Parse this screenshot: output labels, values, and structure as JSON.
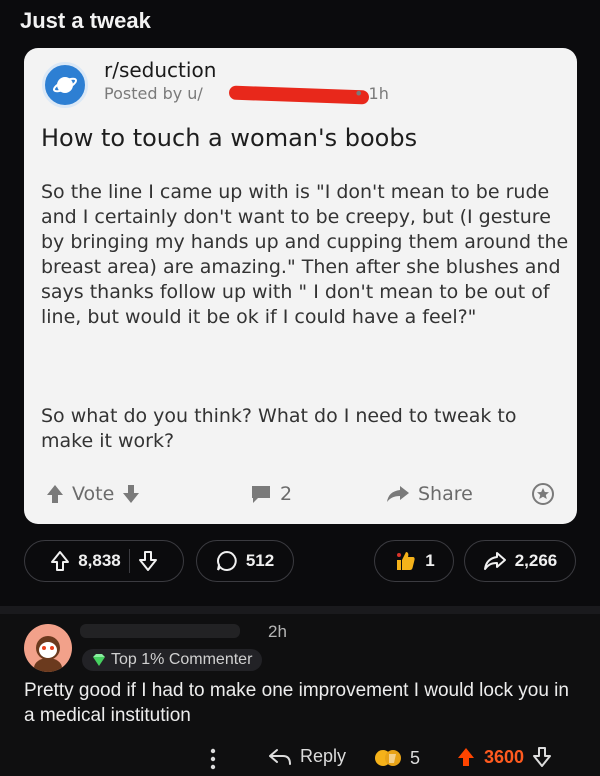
{
  "post": {
    "title": "Just a tweak",
    "stats": {
      "upvotes": "8,838",
      "comments": "512",
      "awards": "1",
      "shares": "2,266"
    }
  },
  "screenshot_card": {
    "subreddit": "r/seduction",
    "posted_by": "Posted by u/",
    "age": "• 1h",
    "title": "How to touch a woman's boobs",
    "body_p1": "So the line I came up with is \"I don't mean to be rude and I certainly don't want to be creepy, but (I gesture by bringing my hands up and cupping them around the breast area) are amazing.\" Then after she blushes and says thanks follow up with \" I don't mean to be out of line, but would it be ok if I could have a feel?\"",
    "body_p2": "So what do you think? What do I need to tweak to make it work?",
    "vote_label": "Vote",
    "comment_count": "2",
    "share_label": "Share"
  },
  "comment": {
    "time": "2h",
    "badge": "Top 1% Commenter",
    "text": "Pretty good if I had to make one improvement I would lock you in a medical institution",
    "reply_label": "Reply",
    "award_count": "5",
    "score": "3600"
  },
  "colors": {
    "upvote_accent": "#ff4500",
    "redaction": "#e8281b",
    "subreddit_icon": "#2d7fd3"
  }
}
